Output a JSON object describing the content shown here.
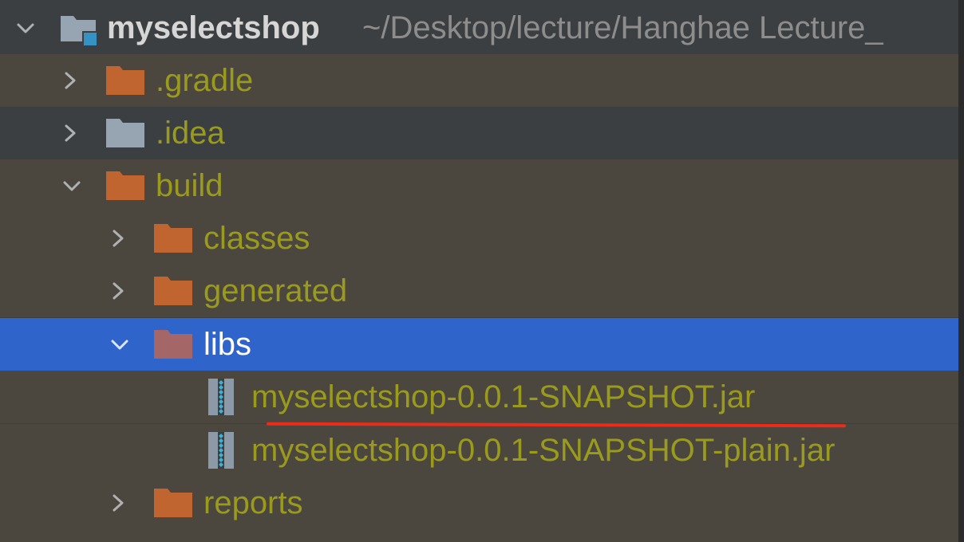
{
  "project": {
    "name": "myselectshop",
    "path": "~/Desktop/lecture/Hanghae Lecture_"
  },
  "tree": {
    "gradle": ".gradle",
    "idea": ".idea",
    "build": "build",
    "classes": "classes",
    "generated": "generated",
    "libs": "libs",
    "jar1": "myselectshop-0.0.1-SNAPSHOT.jar",
    "jar2": "myselectshop-0.0.1-SNAPSHOT-plain.jar",
    "reports": "reports"
  },
  "colors": {
    "folder_orange": "#c0652f",
    "folder_grey": "#97a4b1",
    "folder_selected": "#a46666",
    "text_olive": "#9a9a1d",
    "selection_blue": "#2f65ca",
    "highlight_red": "#ee2a18"
  },
  "icons": {
    "chevron_right": "chevron-right-icon",
    "chevron_down": "chevron-down-icon",
    "folder": "folder-icon",
    "jar": "archive-icon",
    "module": "module-folder-icon"
  }
}
